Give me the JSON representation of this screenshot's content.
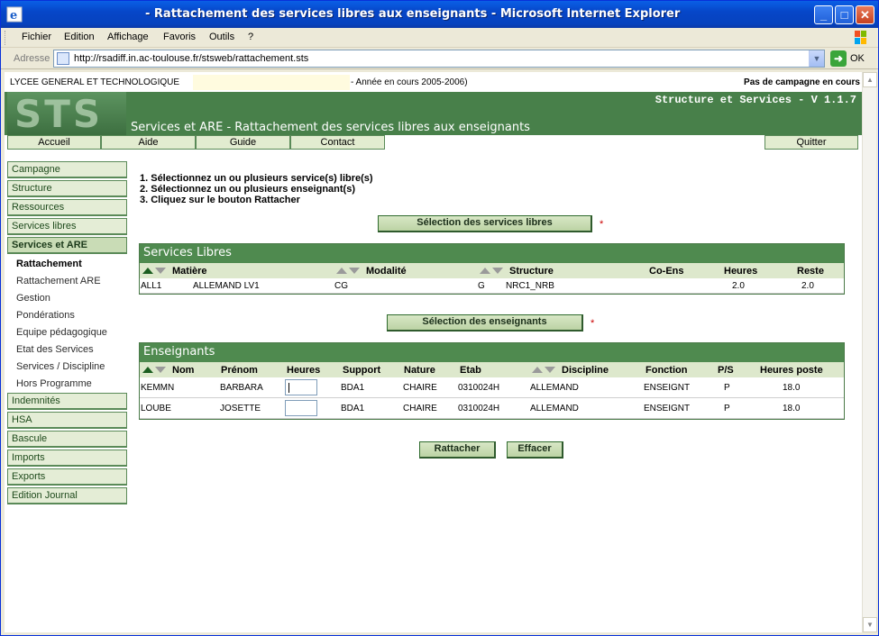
{
  "window": {
    "title": "- Rattachement des services libres aux enseignants - Microsoft Internet Explorer",
    "minimize": "_",
    "maximize": "□",
    "close": "✕"
  },
  "menu": [
    "Fichier",
    "Edition",
    "Affichage",
    "Favoris",
    "Outils",
    "?"
  ],
  "address": {
    "label": "Adresse",
    "url": "http://rsadiff.in.ac-toulouse.fr/stsweb/rattachement.sts",
    "go": "OK"
  },
  "header": {
    "school": "LYCEE GENERAL ET TECHNOLOGIQUE",
    "year": "- Année en cours 2005-2006)",
    "campaign": "Pas de campagne en cours",
    "logo_text": "STS",
    "version": "Structure et Services - V 1.1.7",
    "page_title": "Services et ARE - Rattachement des services libres aux enseignants"
  },
  "nav": {
    "accueil": "Accueil",
    "aide": "Aide",
    "guide": "Guide",
    "contact": "Contact",
    "quitter": "Quitter"
  },
  "sidebar": {
    "campagne": "Campagne",
    "structure": "Structure",
    "ressources": "Ressources",
    "services_libres": "Services libres",
    "services_are": "Services et ARE",
    "sub": [
      "Rattachement",
      "Rattachement ARE",
      "Gestion",
      "Pondérations",
      "Equipe pédagogique",
      "Etat des Services",
      "Services / Discipline",
      "Hors Programme"
    ],
    "indemnites": "Indemnités",
    "hsa": "HSA",
    "bascule": "Bascule",
    "imports": "Imports",
    "exports": "Exports",
    "edition_journal": "Edition Journal"
  },
  "instructions": [
    "1. Sélectionnez un ou plusieurs service(s) libre(s)",
    "2. Sélectionnez un ou plusieurs enseignant(s)",
    "3. Cliquez sur le bouton Rattacher"
  ],
  "select_services_button": "Sélection des services libres",
  "select_teachers_button": "Sélection des enseignants",
  "required_mark": "*",
  "services_panel": {
    "title": "Services Libres",
    "columns": {
      "matiere": "Matière",
      "modalite": "Modalité",
      "structure": "Structure",
      "coens": "Co-Ens",
      "heures": "Heures",
      "reste": "Reste"
    },
    "rows": [
      {
        "code": "ALL1",
        "matiere": "ALLEMAND LV1",
        "modalite": "CG",
        "type": "G",
        "structure": "NRC1_NRB",
        "coens": "",
        "heures": "2.0",
        "reste": "2.0"
      }
    ]
  },
  "teachers_panel": {
    "title": "Enseignants",
    "columns": {
      "nom": "Nom",
      "prenom": "Prénom",
      "heures": "Heures",
      "support": "Support",
      "nature": "Nature",
      "etab": "Etab",
      "discipline": "Discipline",
      "fonction": "Fonction",
      "ps": "P/S",
      "heures_poste": "Heures poste"
    },
    "rows": [
      {
        "nom": "KEMMN",
        "prenom": "BARBARA",
        "heures": "",
        "support": "BDA1",
        "nature": "CHAIRE",
        "etab": "0310024H",
        "discipline": "ALLEMAND",
        "fonction": "ENSEIGNT",
        "ps": "P",
        "heures_poste": "18.0"
      },
      {
        "nom": "LOUBE",
        "prenom": "JOSETTE",
        "heures": "",
        "support": "BDA1",
        "nature": "CHAIRE",
        "etab": "0310024H",
        "discipline": "ALLEMAND",
        "fonction": "ENSEIGNT",
        "ps": "P",
        "heures_poste": "18.0"
      }
    ]
  },
  "actions": {
    "rattacher": "Rattacher",
    "effacer": "Effacer"
  }
}
